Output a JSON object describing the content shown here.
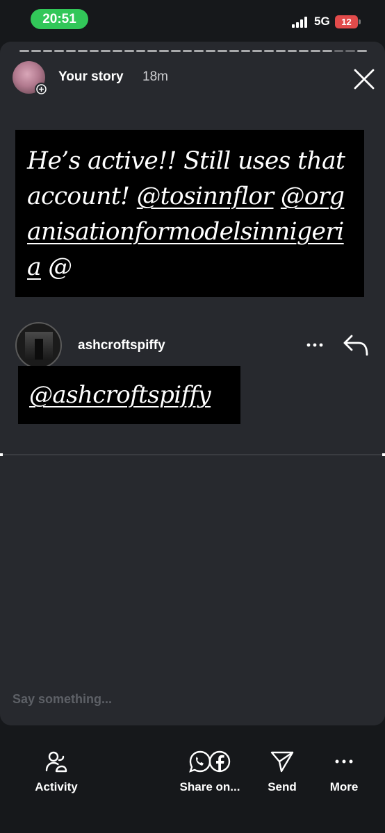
{
  "status_bar": {
    "time": "20:51",
    "network": "5G",
    "battery": "12",
    "battery_color": "#e24b4b",
    "time_pill_color": "#32c759"
  },
  "story": {
    "owner": "Your story",
    "time_ago": "18m",
    "close_icon": "close-icon",
    "text_plain": "He’s active!! Still uses that account! ",
    "text_mention_1": "@tosinnflor",
    "text_mention_2": "@organisationformodelsinnigeria",
    "text_tail": " @"
  },
  "shared_post": {
    "username": "ashcroftspiffy",
    "mention": "@ashcroftspiffy",
    "more_icon": "more-horizontal-icon",
    "reply_icon": "reply-arrow-icon"
  },
  "reply_box": {
    "placeholder": "Say something..."
  },
  "actions": [
    {
      "label": "Activity",
      "icon": "activity-people-icon"
    },
    {
      "label": "Share on...",
      "icon": "whatsapp-facebook-icon"
    },
    {
      "label": "Send",
      "icon": "send-paper-plane-icon"
    },
    {
      "label": "More",
      "icon": "more-dots-icon"
    }
  ]
}
